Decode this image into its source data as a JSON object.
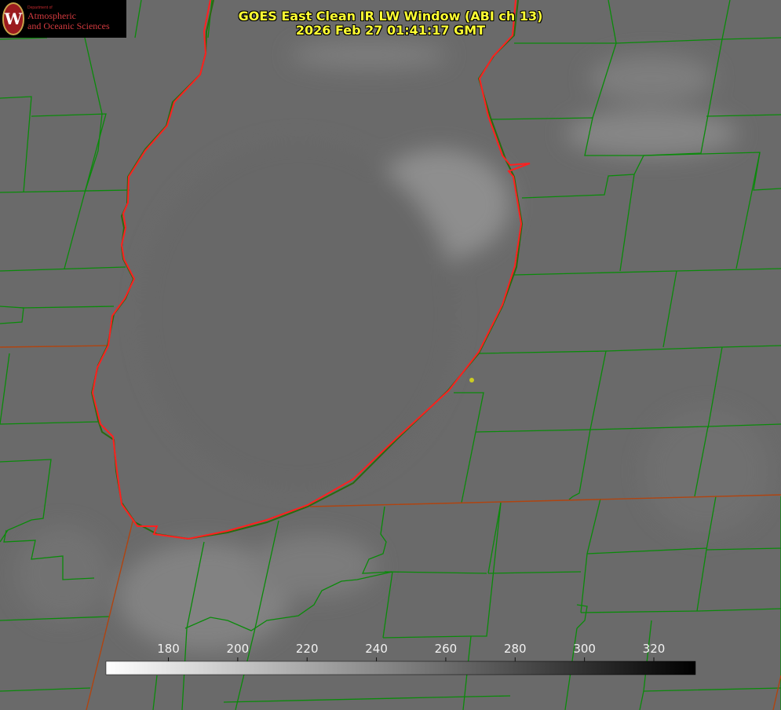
{
  "header": {
    "title_line1": "GOES East Clean IR LW Window (ABI ch 13)",
    "title_line2": "2026 Feb 27 01:41:17 GMT"
  },
  "logo": {
    "icon": "uw-crest-icon",
    "seal_letter": "W",
    "department": "Department of",
    "line1": "Atmospheric",
    "line2": "and Oceanic Sciences"
  },
  "colorbar": {
    "ticks": [
      "180",
      "200",
      "220",
      "240",
      "260",
      "280",
      "300",
      "320"
    ],
    "tick_values": [
      180,
      200,
      220,
      240,
      260,
      280,
      300,
      320
    ],
    "range": [
      162,
      332
    ],
    "color_low": "#ffffff",
    "color_high": "#000000"
  },
  "colors": {
    "county_lines": "#0a8a0a",
    "state_lines": "#b04410",
    "lake_shore": "#ff2020",
    "title_text": "#ffff33",
    "marker": "#cccc22"
  }
}
